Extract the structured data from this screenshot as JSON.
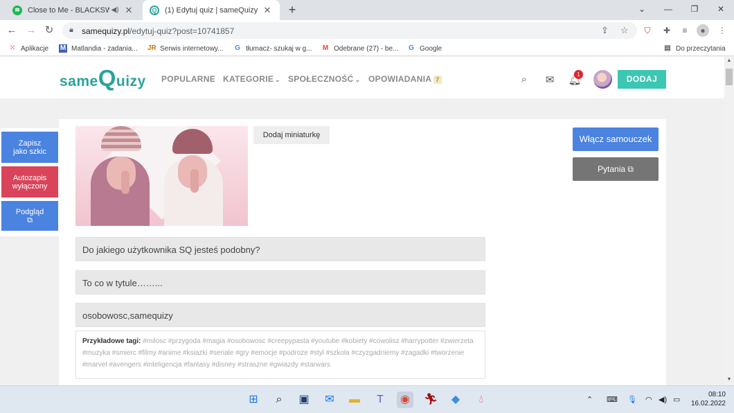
{
  "browser": {
    "tabs": [
      {
        "title": "Close to Me - BLACKSWAN",
        "active": false
      },
      {
        "title": "(1) Edytuj quiz | sameQuizy",
        "active": true
      }
    ],
    "new_tab": "+",
    "window": {
      "minimize": "⌄",
      "min": "—",
      "restore": "❐",
      "close": "✕"
    },
    "url_host": "samequizy.pl",
    "url_path": "/edytuj-quiz?post=10741857",
    "bookmarks": [
      {
        "label": "Aplikacje",
        "icon": "apps-grid-icon"
      },
      {
        "label": "Matlandia - zadania...",
        "icon": "m-icon"
      },
      {
        "label": "Serwis internetowy...",
        "icon": "jr-icon"
      },
      {
        "label": "tłumacz- szukaj w g...",
        "icon": "google-icon"
      },
      {
        "label": "Odebrane (27) - be...",
        "icon": "gmail-icon"
      },
      {
        "label": "Google",
        "icon": "google-icon"
      }
    ],
    "reading_list": "Do przeczytania"
  },
  "site": {
    "logo_prefix": "same",
    "logo_q": "Q",
    "logo_suffix": "uizy",
    "menu": {
      "popularne": "POPULARNE",
      "kategorie": "KATEGORIE",
      "spolecznosc": "SPOŁECZNOŚĆ",
      "opowiadania": "OPOWIADANIA",
      "opowiadania_badge": "7"
    },
    "notification_count": "1",
    "dodaj_label": "DODAJ"
  },
  "editor": {
    "side_buttons": {
      "draft_line1": "Zapisz",
      "draft_line2": "jako szkic",
      "autosave_line1": "Autozapis",
      "autosave_line2": "wyłączony",
      "preview": "Podgląd"
    },
    "add_thumbnail": "Dodaj miniaturkę",
    "tutorial_button": "Włącz samouczek",
    "questions_button": "Pytania",
    "title_value": "Do jakiego użytkownika SQ jesteś podobny?",
    "subtitle_value": "To co w tytule……...",
    "tags_value": "osobowosc,samequizy",
    "example_tags_label": "Przykładowe tagi:",
    "example_tags": "#milosc #przygoda #magia #osobowosc #creepypasta #youtube #kobiety #cowolisz #harrypotter #zwierzeta #muzyka #smierc #filmy #anime #ksiazki #seriale #gry #emocje #podroze #styl #szkola #czyzgadniemy #zagadki #tworzenie #marvel #avengers #inteligencja #fantasy #disney #straszne #gwiazdy #starwars"
  },
  "taskbar": {
    "time": "08:10",
    "date": "16.02.2022"
  },
  "colors": {
    "brand_teal": "#2ba39a",
    "dodaj_green": "#3cc7b3",
    "blue_button": "#4a83e0",
    "red_button": "#d9445a",
    "grey_button": "#757575"
  }
}
